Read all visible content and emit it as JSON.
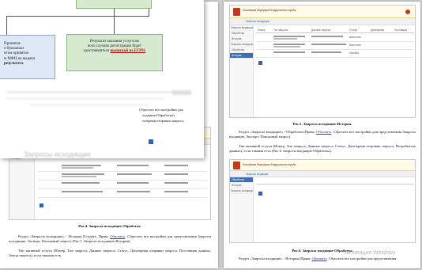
{
  "right_page": {
    "screenshot_top": {
      "rows": [
        "",
        "",
        ""
      ]
    },
    "caption_top": "Рис.5. Запросы исходящие-История.",
    "paragraph1_a": "Раздел «Запросы входящие» - Обработка (Права, ",
    "paragraph1_link": "Обновить",
    "paragraph1_b": ". Сбросить все настройки для представления Запросы входящие, Экспорт, Поисковый запрос).",
    "paragraph2": "Тип активной услуги (Номер, Тип запроса, Данные запроса, Статус, Дата/время отправки запроса, Потребитель данных), если таковая есть (Рис.6. Запросы входящие-Обработка).",
    "caption_bottom": "Рис.6. Запросы входящие-Обработка.",
    "paragraph3_a": "Раздел «Запросы входящие» - История (Права, ",
    "paragraph3_link": "Обновить",
    "paragraph3_b": ". Сбросить все настройки для представления",
    "watermark": "Активация Windows"
  },
  "left_page": {
    "caption": "Рис.4. Запросы исходящие-Обработка.",
    "paragraph1_a": "Раздел «Запросы исходящие» - История (Создать, Права, ",
    "paragraph1_link": "Обновить",
    "paragraph1_b": ". Сбросить все настройки для представления Запросы исходящие, Экспорт, Поисковый запрос) (Рис.5. Запросы исходящие-История).",
    "paragraph2": "Тип активной услуги (Номер, Тип запроса, Данные запроса, Статус, Дата/время отправки запроса, Поставщик данных, Автор запроса), если таковая есть."
  },
  "front_page": {
    "flow_left_lines": [
      "Принятие",
      "е бумажных",
      "нтом  принятое",
      "м МФЦ на выдачи",
      "результата"
    ],
    "flow_right_lines": [
      "Результат оказания услуги во",
      "всех случаях регистрации будет",
      "удостоверяться"
    ],
    "flow_right_red": "выпиской из ЕГРН.",
    "text_line1": "Сбросить все настройки для",
    "text_line2": "ходящие-Обработка).",
    "text_line3": "та/время отправки запроса,",
    "blur_text": "Запросы исходящие"
  },
  "app": {
    "header_title": "Российская Федерация Федеральная служба",
    "breadcrumb": "Запросы исходящие",
    "sidebar_items": [
      "Запросы входящие",
      "Обработка",
      "История",
      "Запросы исходящие",
      "Обработка",
      "История"
    ],
    "table_headers": [
      "Номер",
      "Тип запроса",
      "Данные запроса",
      "Статус",
      "Дата/время",
      "Поставщик"
    ],
    "status_values": [
      "Выполнен",
      "Выполнен",
      "Ошибка"
    ]
  }
}
